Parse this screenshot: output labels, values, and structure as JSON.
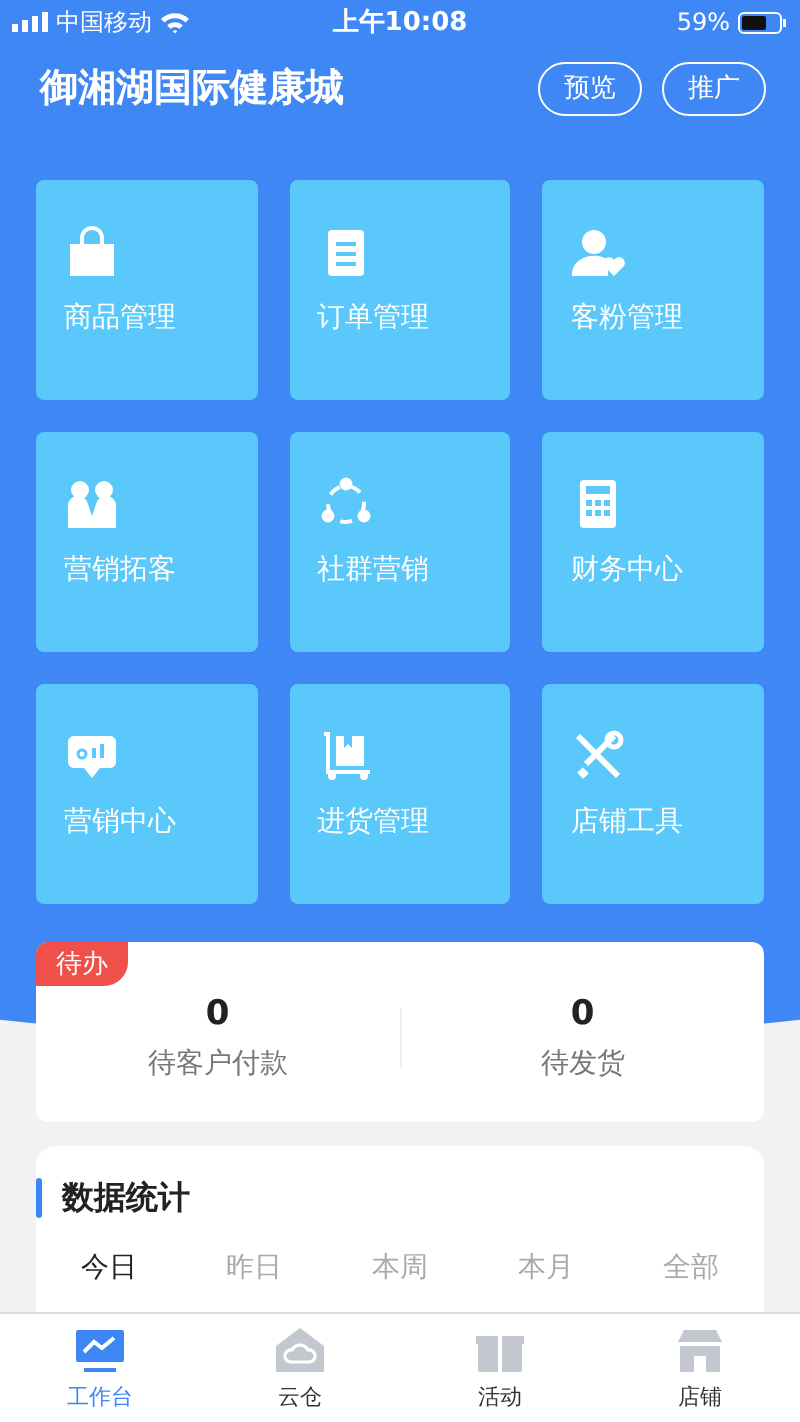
{
  "status_bar": {
    "carrier": "中国移动",
    "time": "上午10:08",
    "battery": "59%"
  },
  "header": {
    "title": "御湘湖国际健康城",
    "buttons": [
      "预览",
      "推广"
    ]
  },
  "grid": [
    {
      "label": "商品管理"
    },
    {
      "label": "订单管理"
    },
    {
      "label": "客粉管理"
    },
    {
      "label": "营销拓客"
    },
    {
      "label": "社群营销"
    },
    {
      "label": "财务中心"
    },
    {
      "label": "营销中心"
    },
    {
      "label": "进货管理"
    },
    {
      "label": "店铺工具"
    }
  ],
  "todo": {
    "badge": "待办",
    "items": [
      {
        "value": "0",
        "label": "待客户付款"
      },
      {
        "value": "0",
        "label": "待发货"
      }
    ]
  },
  "stats": {
    "title": "数据统计",
    "periods": [
      {
        "label": "今日",
        "selected": true
      },
      {
        "label": "昨日",
        "selected": false
      },
      {
        "label": "本周",
        "selected": false
      },
      {
        "label": "本月",
        "selected": false
      },
      {
        "label": "全部",
        "selected": false
      }
    ]
  },
  "tab_bar": [
    {
      "label": "工作台",
      "selected": true
    },
    {
      "label": "云仓",
      "selected": false
    },
    {
      "label": "活动",
      "selected": false
    },
    {
      "label": "店铺",
      "selected": false
    }
  ]
}
